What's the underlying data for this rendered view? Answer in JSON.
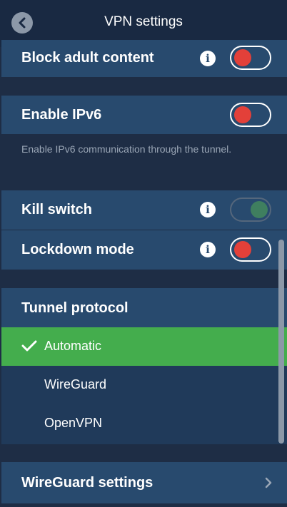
{
  "header": {
    "title": "VPN settings",
    "back_icon": "chevron-left-icon"
  },
  "settings": {
    "block_adult_content": {
      "label": "Block adult content",
      "state": "off",
      "info_icon": "i"
    },
    "enable_ipv6": {
      "label": "Enable IPv6",
      "state": "off",
      "footer": "Enable IPv6 communication through the tunnel."
    },
    "kill_switch": {
      "label": "Kill switch",
      "state": "on-disabled",
      "info_icon": "i"
    },
    "lockdown_mode": {
      "label": "Lockdown mode",
      "state": "off",
      "info_icon": "i"
    }
  },
  "tunnel_protocol": {
    "label": "Tunnel protocol",
    "options": [
      {
        "label": "Automatic",
        "selected": true
      },
      {
        "label": "WireGuard",
        "selected": false
      },
      {
        "label": "OpenVPN",
        "selected": false
      }
    ]
  },
  "wireguard_settings": {
    "label": "WireGuard settings",
    "chevron_icon": "chevron-right-icon"
  },
  "colors": {
    "background": "#1e2d45",
    "row": "#284a6e",
    "selected": "#44ad4d",
    "toggle_off": "#e34039",
    "toggle_on_dim": "#3f7f5f"
  }
}
